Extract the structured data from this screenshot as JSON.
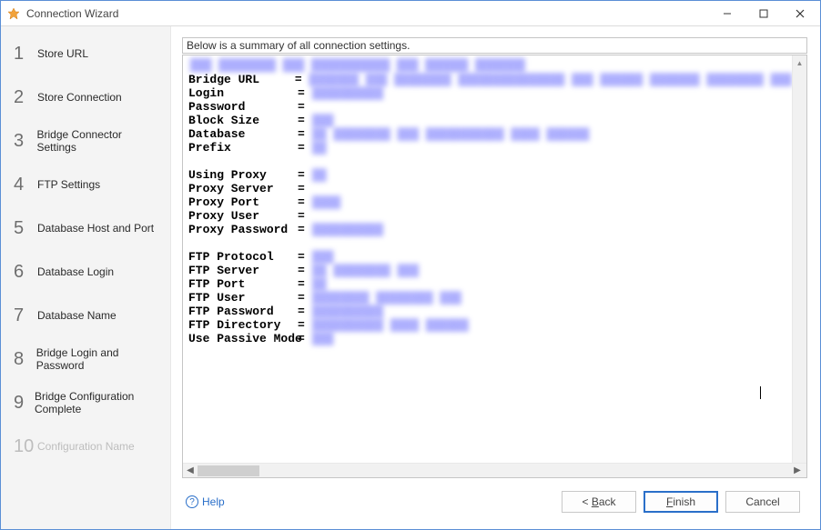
{
  "window": {
    "title": "Connection Wizard"
  },
  "sidebar": {
    "steps": [
      {
        "num": "1",
        "label": "Store URL"
      },
      {
        "num": "2",
        "label": "Store Connection"
      },
      {
        "num": "3",
        "label": "Bridge Connector Settings"
      },
      {
        "num": "4",
        "label": "FTP Settings"
      },
      {
        "num": "5",
        "label": "Database Host and Port"
      },
      {
        "num": "6",
        "label": "Database Login"
      },
      {
        "num": "7",
        "label": "Database Name"
      },
      {
        "num": "8",
        "label": "Bridge Login and Password"
      },
      {
        "num": "9",
        "label": "Bridge Configuration Complete"
      },
      {
        "num": "10",
        "label": "Configuration Name"
      }
    ]
  },
  "summary_label": "Below is a summary of all connection settings.",
  "top_line": "███ ████████ ███ ███████████ ███ ██████     ███████",
  "rows": [
    {
      "key": "Bridge URL",
      "val": "███████ ███ ████████ ███████████████ ███ ██████ ███████ ████████ ███"
    },
    {
      "key": "Login",
      "val": "██████████"
    },
    {
      "key": "Password",
      "val": ""
    },
    {
      "key": "Block Size",
      "val": "███"
    },
    {
      "key": "Database",
      "val": "██ ████████ ███ ███████████ ████ ██████"
    },
    {
      "key": "Prefix",
      "val": "██"
    },
    {
      "spacer": true
    },
    {
      "key": "Using Proxy",
      "val": "██"
    },
    {
      "key": "Proxy Server",
      "val": ""
    },
    {
      "key": "Proxy Port",
      "val": "████"
    },
    {
      "key": "Proxy User",
      "val": ""
    },
    {
      "key": "Proxy Password",
      "val": "██████████"
    },
    {
      "spacer": true
    },
    {
      "key": "FTP Protocol",
      "val": "███"
    },
    {
      "key": "FTP Server",
      "val": "██ ████████ ███"
    },
    {
      "key": "FTP Port",
      "val": "██"
    },
    {
      "key": "FTP User",
      "val": "████████ ████████ ███"
    },
    {
      "key": "FTP Password",
      "val": "██████████"
    },
    {
      "key": "FTP Directory",
      "val": "██████████ ████ ██████"
    },
    {
      "key": "Use Passive Mode",
      "val": "███"
    }
  ],
  "footer": {
    "help": "Help",
    "back": "Back",
    "finish": "Finish",
    "cancel": "Cancel"
  }
}
